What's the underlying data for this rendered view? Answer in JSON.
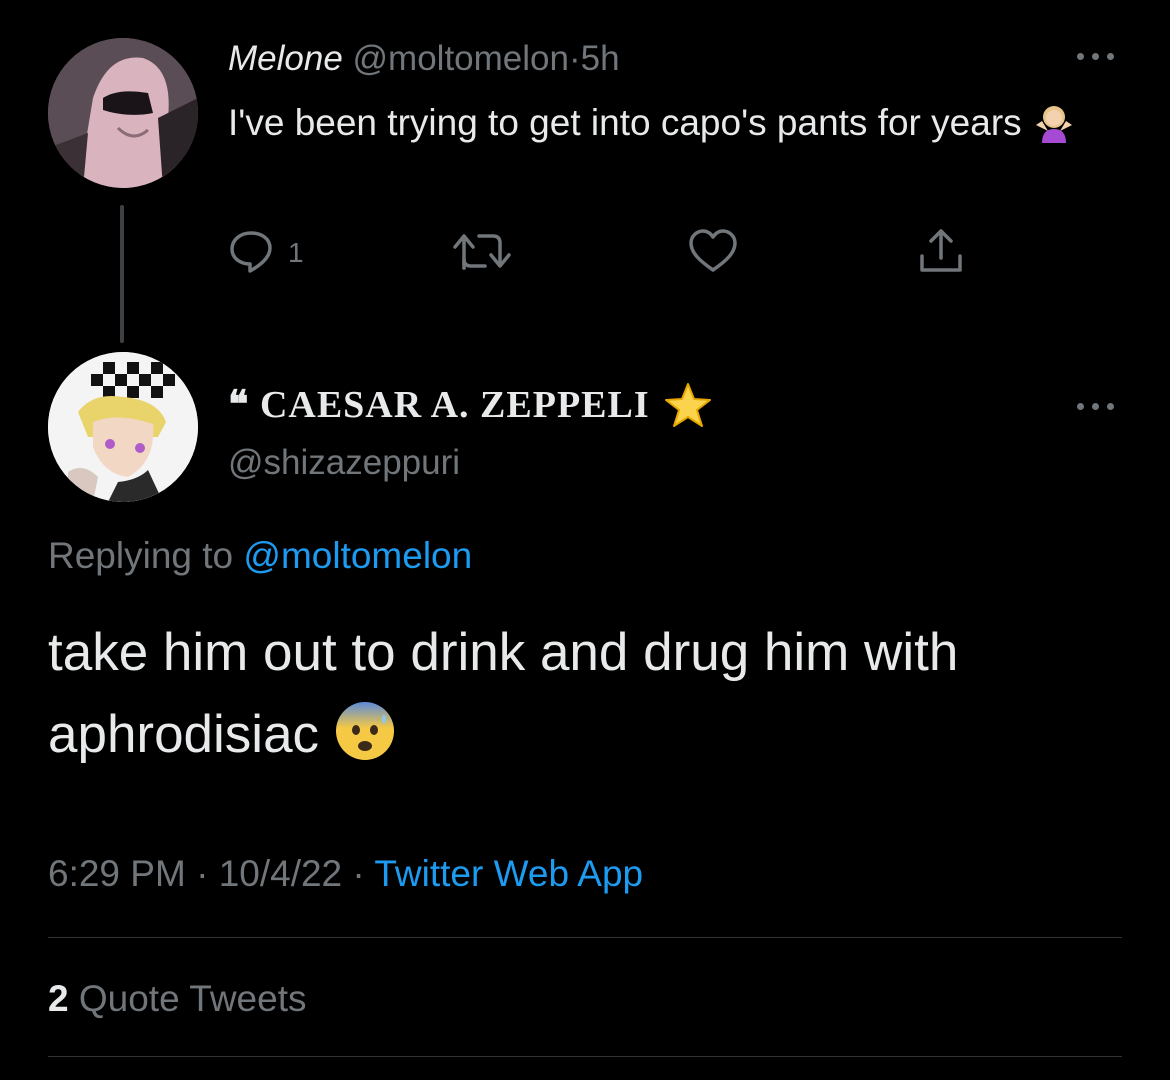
{
  "parent_tweet": {
    "display_name": "Melone",
    "handle": "@moltomelon",
    "separator": "·",
    "time_ago": "5h",
    "text": "I've been trying to get into capo's pants for years",
    "emoji": "woman-shrugging",
    "actions": {
      "reply_count": "1",
      "reply_icon": "reply-icon",
      "retweet_icon": "retweet-icon",
      "like_icon": "heart-icon",
      "share_icon": "share-icon"
    }
  },
  "main_tweet": {
    "display_name": "❝ CAESAR A. ZEPPELI",
    "name_emoji": "star",
    "handle": "@shizazeppuri",
    "replying_label": "Replying to",
    "replying_handle": "@moltomelon",
    "text": "take him out to drink and drug him with aphrodisiac",
    "emoji": "anxious-face-with-sweat",
    "time": "6:29 PM",
    "separator": "·",
    "date": "10/4/22",
    "source": "Twitter Web App",
    "quote_count": "2",
    "quote_label": "Quote Tweets"
  },
  "colors": {
    "background": "#000000",
    "text": "#e7e9ea",
    "muted": "#71767b",
    "link": "#1d9bf0",
    "divider": "#2f3336"
  }
}
